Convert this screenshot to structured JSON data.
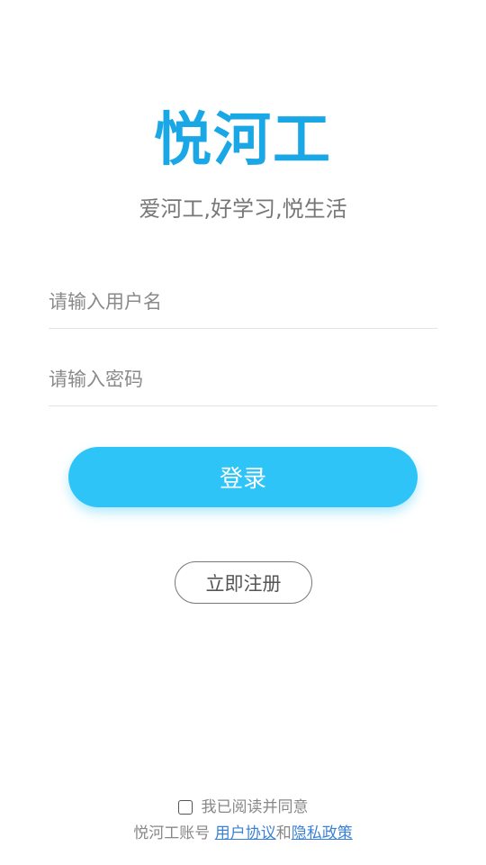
{
  "app": {
    "title": "悦河工",
    "slogan": "爱河工,好学习,悦生活"
  },
  "form": {
    "username_placeholder": "请输入用户名",
    "password_placeholder": "请输入密码",
    "username_value": "",
    "password_value": ""
  },
  "buttons": {
    "login_label": "登录",
    "register_label": "立即注册"
  },
  "agreement": {
    "checked": false,
    "agree_text": "我已阅读并同意",
    "prefix_text": "悦河工账号",
    "user_agreement_label": "用户协议",
    "and_text": "和",
    "privacy_policy_label": "隐私政策"
  },
  "colors": {
    "title": "#1aa7e6",
    "button": "#2ec4f7",
    "link": "#3b82d6"
  }
}
